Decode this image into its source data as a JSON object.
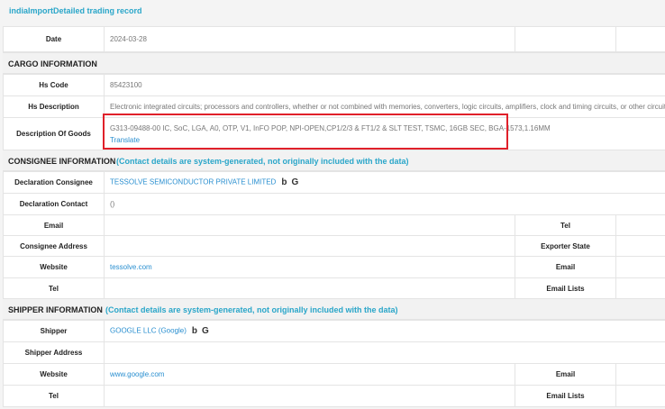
{
  "header": {
    "title": "indiaImportDetailed trading record"
  },
  "date_row": {
    "label": "Date",
    "value": "2024-03-28"
  },
  "cargo": {
    "title": "CARGO INFORMATION",
    "hs_code_label": "Hs Code",
    "hs_code": "85423100",
    "hs_desc_label": "Hs Description",
    "hs_desc": "Electronic integrated circuits; processors and controllers, whether or not combined with memories, converters, logic circuits, amplifiers, clock and timing circuits, or other circuits",
    "desc_goods_label": "Description Of Goods",
    "desc_goods": "G313-09488-00 IC, SoC, LGA, A0, OTP, V1, InFO POP, NPI-OPEN,CP1/2/3 & FT1/2 & SLT TEST, TSMC, 16GB SEC, BGA-1573,1.16MM",
    "translate": "Translate"
  },
  "consignee": {
    "title": "CONSIGNEE INFORMATION",
    "note": "(Contact details are system-generated, not originally included with the data)",
    "decl_consignee_label": "Declaration Consignee",
    "decl_consignee": "TESSOLVE SEMICONDUCTOR PRIVATE LIMITED",
    "decl_contact_label": "Declaration Contact",
    "decl_contact": "()",
    "email_label": "Email",
    "tel_label": "Tel",
    "address_label": "Consignee Address",
    "exporter_state_label": "Exporter State",
    "website_label": "Website",
    "website": "tessolve.com",
    "email2_label": "Email",
    "tel2_label": "Tel",
    "email_lists_label": "Email Lists"
  },
  "shipper": {
    "title": "SHIPPER INFORMATION",
    "note": "(Contact details are system-generated, not originally included with the data)",
    "shipper_label": "Shipper",
    "shipper": "GOOGLE LLC (Google)",
    "address_label": "Shipper Address",
    "website_label": "Website",
    "website": "www.google.com",
    "email_label": "Email",
    "tel_label": "Tel",
    "email_lists_label": "Email Lists"
  },
  "icons": {
    "bing": "bing-icon",
    "google": "google-icon"
  },
  "colors": {
    "accent": "#2aa6c9",
    "link": "#2a8fd0",
    "highlight": "#e0202a"
  }
}
